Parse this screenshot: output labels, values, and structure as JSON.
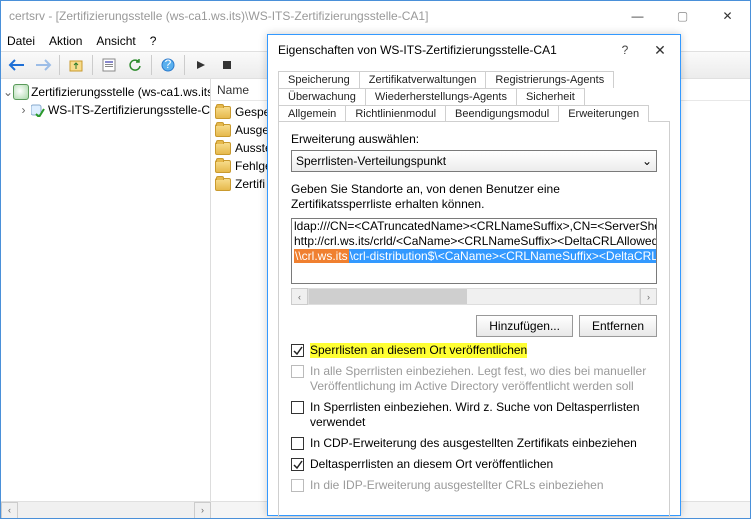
{
  "window": {
    "title": "certsrv - [Zertifizierungsstelle (ws-ca1.ws.its)\\WS-ITS-Zertifizierungsstelle-CA1]",
    "min": "—",
    "max": "▢",
    "close": "✕"
  },
  "menu": {
    "file": "Datei",
    "action": "Aktion",
    "view": "Ansicht",
    "help": "?"
  },
  "tree": {
    "root": "Zertifizierungsstelle (ws-ca1.ws.its",
    "ca": "WS-ITS-Zertifizierungsstelle-C"
  },
  "list": {
    "header_name": "Name",
    "items": [
      "Gespe",
      "Ausge",
      "Ausste",
      "Fehlge",
      "Zertifi"
    ]
  },
  "dialog": {
    "title": "Eigenschaften von WS-ITS-Zertifizierungsstelle-CA1",
    "help": "?",
    "close": "✕",
    "tabs_row1": [
      "Speicherung",
      "Zertifikatverwaltungen",
      "Registrierungs-Agents"
    ],
    "tabs_row2": [
      "Überwachung",
      "Wiederherstellungs-Agents",
      "Sicherheit"
    ],
    "tabs_row3": [
      "Allgemein",
      "Richtlinienmodul",
      "Beendigungsmodul",
      "Erweiterungen"
    ],
    "ext_label": "Erweiterung auswählen:",
    "ext_value": "Sperrlisten-Verteilungspunkt",
    "desc": "Geben Sie Standorte an, von denen Benutzer eine Zertifikatssperrliste erhalten können.",
    "entries": {
      "l1": "ldap:///CN=<CATruncatedName><CRLNameSuffix>,CN=<ServerShortNam",
      "l2": "http://crl.ws.its/crld/<CaName><CRLNameSuffix><DeltaCRLAllowed>.crl",
      "l3a": "\\\\crl.ws.its",
      "l3b": "\\crl-distribution$\\<CaName><CRLNameSuffix><DeltaCRLAllowe"
    },
    "add": "Hinzufügen...",
    "remove": "Entfernen",
    "checks": {
      "c1": "Sperrlisten an diesem Ort veröffentlichen",
      "c2": "In alle Sperrlisten einbeziehen. Legt fest, wo dies bei manueller Veröffentlichung im Active Directory veröffentlicht werden soll",
      "c3": "In Sperrlisten einbeziehen. Wird z. Suche von Deltasperrlisten verwendet",
      "c4": "In CDP-Erweiterung des ausgestellten Zertifikats einbeziehen",
      "c5": "Deltasperrlisten an diesem Ort veröffentlichen",
      "c6": "In die IDP-Erweiterung ausgestellter CRLs einbeziehen"
    }
  }
}
